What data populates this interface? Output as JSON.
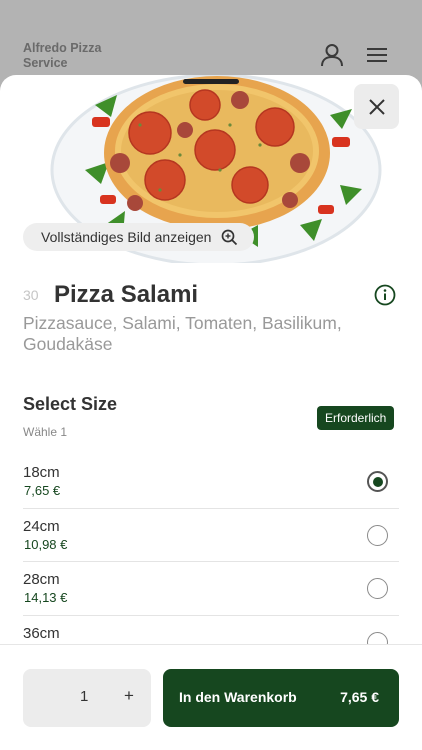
{
  "header": {
    "brand": "Alfredo Pizza Service",
    "icons": [
      "user-icon",
      "menu-icon"
    ]
  },
  "product": {
    "number": "30",
    "name": "Pizza Salami",
    "description": "Pizzasauce, Salami, Tomaten, Basilikum, Goudakäse",
    "full_image_label": "Vollständiges Bild anzeigen"
  },
  "size_section": {
    "title": "Select Size",
    "subtitle": "Wähle 1",
    "badge": "Erforderlich",
    "options": [
      {
        "size": "18cm",
        "price": "7,65 €",
        "selected": true
      },
      {
        "size": "24cm",
        "price": "10,98 €",
        "selected": false
      },
      {
        "size": "28cm",
        "price": "14,13 €",
        "selected": false
      },
      {
        "size": "36cm",
        "price": "",
        "selected": false
      }
    ]
  },
  "footer": {
    "quantity": "1",
    "plus": "+",
    "cart_label": "In den Warenkorb",
    "cart_price": "7,65 €"
  },
  "colors": {
    "accent": "#16471f",
    "backdrop": "#b3b3b3"
  }
}
